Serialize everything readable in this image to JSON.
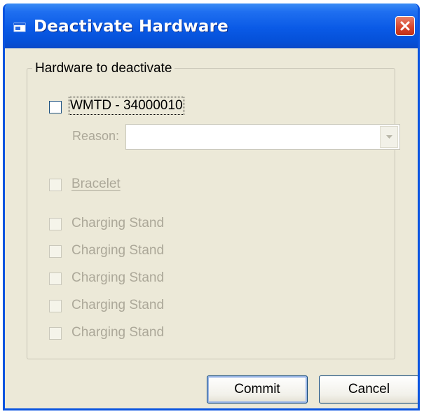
{
  "window": {
    "title": "Deactivate Hardware",
    "accent_color": "#0a5ae6",
    "close_icon": "close-x-icon",
    "title_icon": "window-app-icon"
  },
  "group": {
    "title": "Hardware to deactivate"
  },
  "device": {
    "label": "WMTD - 34000010",
    "checked": false,
    "reason_label": "Reason:",
    "reason_value": ""
  },
  "bracelet": {
    "label": "Bracelet",
    "checked": false
  },
  "charging_stands": [
    {
      "label": "Charging Stand",
      "checked": false
    },
    {
      "label": "Charging Stand",
      "checked": false
    },
    {
      "label": "Charging Stand",
      "checked": false
    },
    {
      "label": "Charging Stand",
      "checked": false
    },
    {
      "label": "Charging Stand",
      "checked": false
    }
  ],
  "buttons": {
    "commit": "Commit",
    "cancel": "Cancel"
  }
}
